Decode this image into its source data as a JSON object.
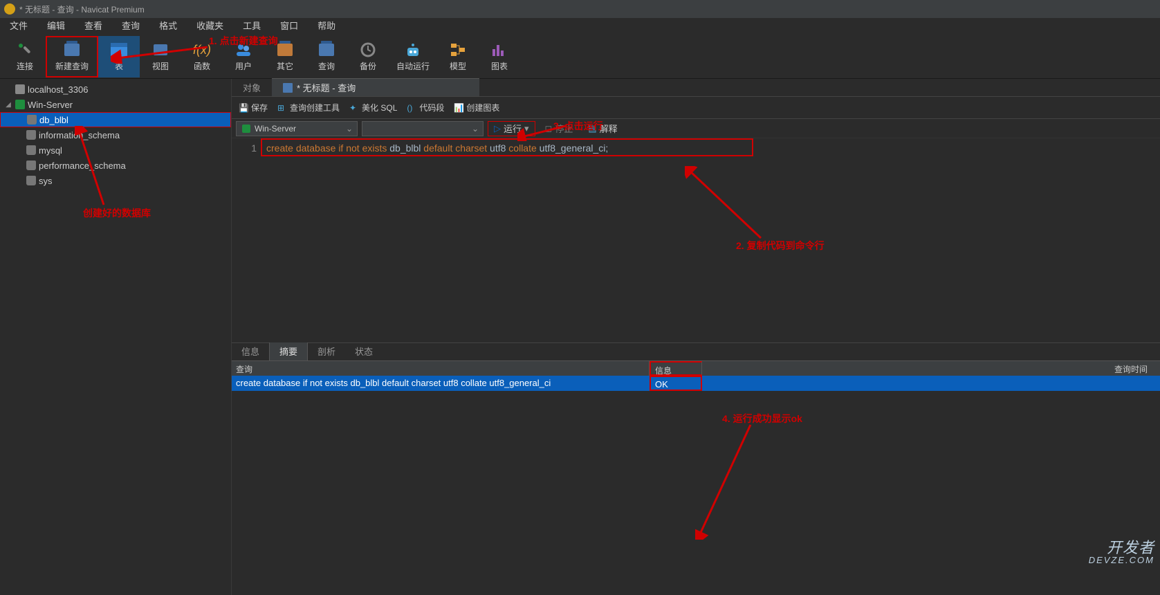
{
  "window": {
    "title": "* 无标题 - 查询 - Navicat Premium"
  },
  "menu": [
    "文件",
    "编辑",
    "查看",
    "查询",
    "格式",
    "收藏夹",
    "工具",
    "窗口",
    "帮助"
  ],
  "ribbon": [
    {
      "id": "connect",
      "label": "连接"
    },
    {
      "id": "new-query",
      "label": "新建查询"
    },
    {
      "id": "table",
      "label": "表"
    },
    {
      "id": "view",
      "label": "视图"
    },
    {
      "id": "function",
      "label": "函数"
    },
    {
      "id": "user",
      "label": "用户"
    },
    {
      "id": "other",
      "label": "其它"
    },
    {
      "id": "query",
      "label": "查询"
    },
    {
      "id": "backup",
      "label": "备份"
    },
    {
      "id": "autorun",
      "label": "自动运行"
    },
    {
      "id": "model",
      "label": "模型"
    },
    {
      "id": "chart",
      "label": "图表"
    }
  ],
  "tree": {
    "conn1": "localhost_3306",
    "conn2": "Win-Server",
    "dbs": [
      "db_blbl",
      "information_schema",
      "mysql",
      "performance_schema",
      "sys"
    ]
  },
  "tabs": {
    "objects": "对象",
    "query": "* 无标题 - 查询"
  },
  "qtoolbar": {
    "save": "保存",
    "builder": "查询创建工具",
    "beautify": "美化 SQL",
    "snippet": "代码段",
    "chart": "创建图表"
  },
  "conn": {
    "server": "Win-Server",
    "run": "运行",
    "stop": "停止",
    "explain": "解释"
  },
  "code": {
    "line_no": "1",
    "tokens": [
      "create",
      " ",
      "database",
      " ",
      "if",
      " ",
      "not",
      " ",
      "exists",
      " db_blbl ",
      "default",
      " ",
      "charset",
      " utf8 ",
      "collate",
      " utf8_general_ci;"
    ],
    "types": [
      "kw",
      "",
      "kw",
      "",
      "kw",
      "",
      "kw",
      "",
      "kw",
      "id",
      "kw",
      "",
      "kw",
      "id",
      "kw",
      "id"
    ]
  },
  "annotations": {
    "a1": "1. 点击新建查询",
    "a2": "2. 复制代码到命令行",
    "a3": "3. 点击运行",
    "a4": "4. 运行成功显示ok",
    "a5": "创建好的数据库"
  },
  "result": {
    "tabs": [
      "信息",
      "摘要",
      "剖析",
      "状态"
    ],
    "active_tab": "摘要",
    "cols": {
      "query": "查询",
      "info": "信息",
      "time": "查询时间"
    },
    "row": {
      "query": "create database if not exists db_blbl default charset utf8 collate utf8_general_ci",
      "info": "OK"
    }
  },
  "watermark": {
    "l1": "开发者",
    "l2": "DEVZE.COM"
  }
}
